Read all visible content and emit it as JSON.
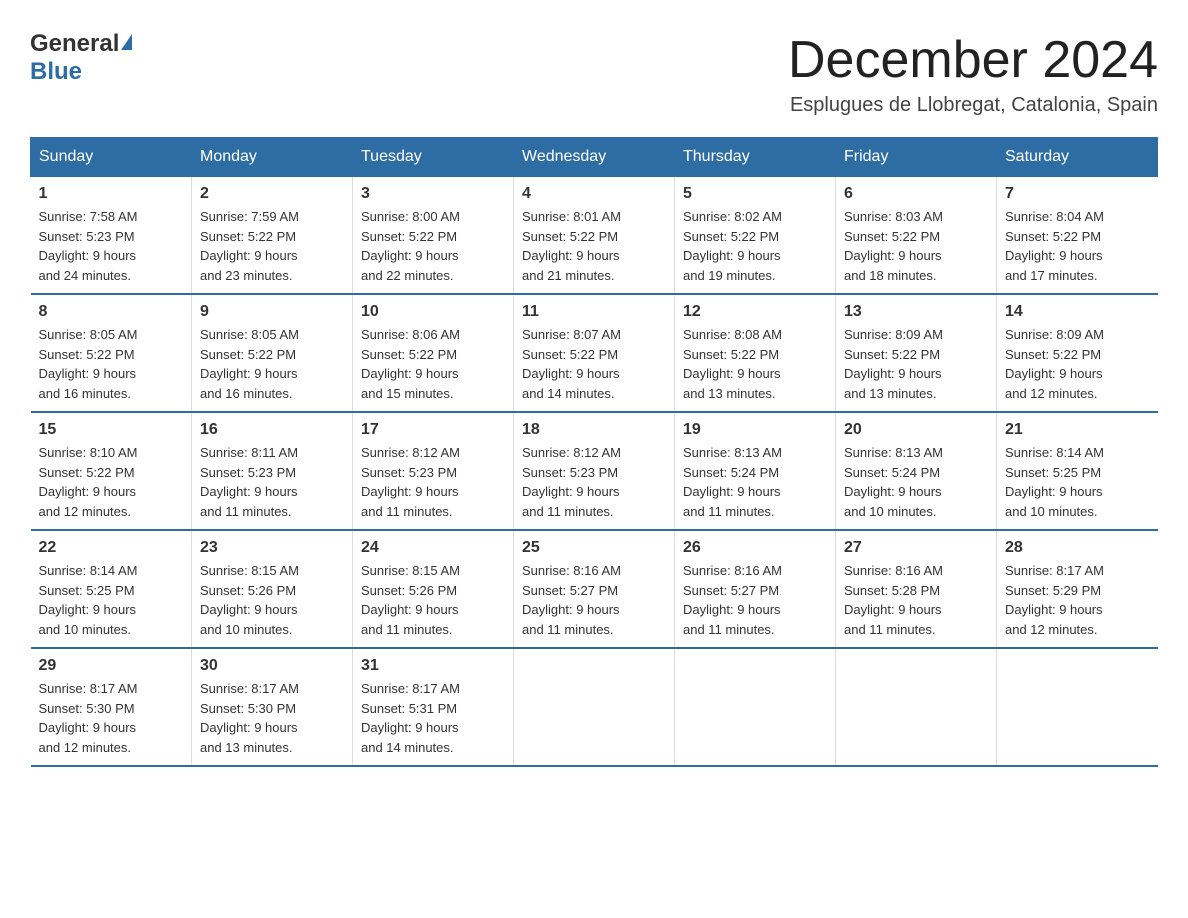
{
  "header": {
    "logo_general": "General",
    "logo_blue": "Blue",
    "title": "December 2024",
    "subtitle": "Esplugues de Llobregat, Catalonia, Spain"
  },
  "days_of_week": [
    "Sunday",
    "Monday",
    "Tuesday",
    "Wednesday",
    "Thursday",
    "Friday",
    "Saturday"
  ],
  "weeks": [
    [
      {
        "day": "1",
        "sunrise": "7:58 AM",
        "sunset": "5:23 PM",
        "daylight": "9 hours and 24 minutes."
      },
      {
        "day": "2",
        "sunrise": "7:59 AM",
        "sunset": "5:22 PM",
        "daylight": "9 hours and 23 minutes."
      },
      {
        "day": "3",
        "sunrise": "8:00 AM",
        "sunset": "5:22 PM",
        "daylight": "9 hours and 22 minutes."
      },
      {
        "day": "4",
        "sunrise": "8:01 AM",
        "sunset": "5:22 PM",
        "daylight": "9 hours and 21 minutes."
      },
      {
        "day": "5",
        "sunrise": "8:02 AM",
        "sunset": "5:22 PM",
        "daylight": "9 hours and 19 minutes."
      },
      {
        "day": "6",
        "sunrise": "8:03 AM",
        "sunset": "5:22 PM",
        "daylight": "9 hours and 18 minutes."
      },
      {
        "day": "7",
        "sunrise": "8:04 AM",
        "sunset": "5:22 PM",
        "daylight": "9 hours and 17 minutes."
      }
    ],
    [
      {
        "day": "8",
        "sunrise": "8:05 AM",
        "sunset": "5:22 PM",
        "daylight": "9 hours and 16 minutes."
      },
      {
        "day": "9",
        "sunrise": "8:05 AM",
        "sunset": "5:22 PM",
        "daylight": "9 hours and 16 minutes."
      },
      {
        "day": "10",
        "sunrise": "8:06 AM",
        "sunset": "5:22 PM",
        "daylight": "9 hours and 15 minutes."
      },
      {
        "day": "11",
        "sunrise": "8:07 AM",
        "sunset": "5:22 PM",
        "daylight": "9 hours and 14 minutes."
      },
      {
        "day": "12",
        "sunrise": "8:08 AM",
        "sunset": "5:22 PM",
        "daylight": "9 hours and 13 minutes."
      },
      {
        "day": "13",
        "sunrise": "8:09 AM",
        "sunset": "5:22 PM",
        "daylight": "9 hours and 13 minutes."
      },
      {
        "day": "14",
        "sunrise": "8:09 AM",
        "sunset": "5:22 PM",
        "daylight": "9 hours and 12 minutes."
      }
    ],
    [
      {
        "day": "15",
        "sunrise": "8:10 AM",
        "sunset": "5:22 PM",
        "daylight": "9 hours and 12 minutes."
      },
      {
        "day": "16",
        "sunrise": "8:11 AM",
        "sunset": "5:23 PM",
        "daylight": "9 hours and 11 minutes."
      },
      {
        "day": "17",
        "sunrise": "8:12 AM",
        "sunset": "5:23 PM",
        "daylight": "9 hours and 11 minutes."
      },
      {
        "day": "18",
        "sunrise": "8:12 AM",
        "sunset": "5:23 PM",
        "daylight": "9 hours and 11 minutes."
      },
      {
        "day": "19",
        "sunrise": "8:13 AM",
        "sunset": "5:24 PM",
        "daylight": "9 hours and 11 minutes."
      },
      {
        "day": "20",
        "sunrise": "8:13 AM",
        "sunset": "5:24 PM",
        "daylight": "9 hours and 10 minutes."
      },
      {
        "day": "21",
        "sunrise": "8:14 AM",
        "sunset": "5:25 PM",
        "daylight": "9 hours and 10 minutes."
      }
    ],
    [
      {
        "day": "22",
        "sunrise": "8:14 AM",
        "sunset": "5:25 PM",
        "daylight": "9 hours and 10 minutes."
      },
      {
        "day": "23",
        "sunrise": "8:15 AM",
        "sunset": "5:26 PM",
        "daylight": "9 hours and 10 minutes."
      },
      {
        "day": "24",
        "sunrise": "8:15 AM",
        "sunset": "5:26 PM",
        "daylight": "9 hours and 11 minutes."
      },
      {
        "day": "25",
        "sunrise": "8:16 AM",
        "sunset": "5:27 PM",
        "daylight": "9 hours and 11 minutes."
      },
      {
        "day": "26",
        "sunrise": "8:16 AM",
        "sunset": "5:27 PM",
        "daylight": "9 hours and 11 minutes."
      },
      {
        "day": "27",
        "sunrise": "8:16 AM",
        "sunset": "5:28 PM",
        "daylight": "9 hours and 11 minutes."
      },
      {
        "day": "28",
        "sunrise": "8:17 AM",
        "sunset": "5:29 PM",
        "daylight": "9 hours and 12 minutes."
      }
    ],
    [
      {
        "day": "29",
        "sunrise": "8:17 AM",
        "sunset": "5:30 PM",
        "daylight": "9 hours and 12 minutes."
      },
      {
        "day": "30",
        "sunrise": "8:17 AM",
        "sunset": "5:30 PM",
        "daylight": "9 hours and 13 minutes."
      },
      {
        "day": "31",
        "sunrise": "8:17 AM",
        "sunset": "5:31 PM",
        "daylight": "9 hours and 14 minutes."
      },
      null,
      null,
      null,
      null
    ]
  ],
  "labels": {
    "sunrise": "Sunrise:",
    "sunset": "Sunset:",
    "daylight": "Daylight:"
  }
}
